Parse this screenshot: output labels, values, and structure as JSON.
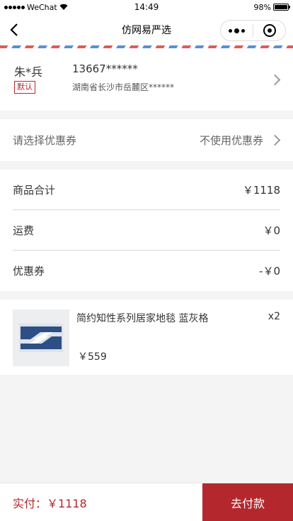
{
  "status_bar": {
    "carrier": "WeChat",
    "time": "14:49",
    "battery": "98%",
    "battery_level": 0.98
  },
  "nav": {
    "title": "仿网易严选"
  },
  "address": {
    "name": "朱*兵",
    "badge": "默认",
    "phone": "13667******",
    "detail": "湖南省长沙市岳麓区******"
  },
  "coupon": {
    "label": "请选择优惠券",
    "value": "不使用优惠券"
  },
  "summary": {
    "rows": [
      {
        "label": "商品合计",
        "value": "￥1118"
      },
      {
        "label": "运费",
        "value": "￥0"
      },
      {
        "label": "优惠券",
        "value": "-￥0"
      }
    ]
  },
  "product": {
    "name": "简约知性系列居家地毯 蓝灰格",
    "quantity": "x2",
    "price": "￥559"
  },
  "footer": {
    "total_label": "实付：￥1118",
    "pay_button": "去付款"
  },
  "colors": {
    "accent": "#b4282d",
    "background": "#f4f4f4"
  }
}
